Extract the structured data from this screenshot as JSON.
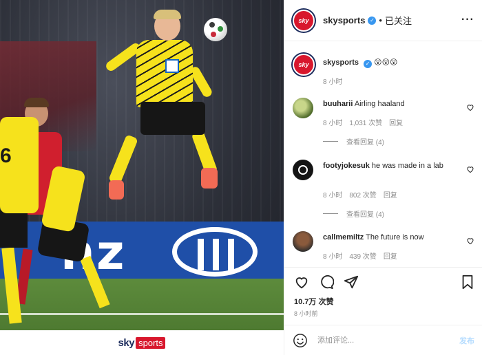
{
  "photo": {
    "alt_icon": "football-photo",
    "ad_text": "nz",
    "watermark": {
      "brand": "sky",
      "sub": "sports"
    },
    "players": {
      "left_number": "6",
      "red_number": "6"
    },
    "colors": {
      "kit_yellow": "#f6e21c",
      "kit_black": "#161616",
      "opponent_red": "#d01f2e",
      "adboard_blue": "#1f4fa8",
      "boot": "#f26b55"
    }
  },
  "header": {
    "avatar_text": "sky",
    "username": "skysports",
    "verified_icon": "verified-badge-icon",
    "separator": "•",
    "follow_status": "已关注",
    "more_icon": "more-options-icon"
  },
  "caption": {
    "username": "skysports",
    "text": "😲😲😲",
    "time": "8 小时"
  },
  "comments": [
    {
      "username": "buuharii",
      "text": "Airling haaland",
      "time": "8 小时",
      "likes": "1,031 次赞",
      "reply": "回复",
      "view_replies": "查看回复 (4)"
    },
    {
      "username": "footyjokesuk",
      "text": "he was made in a lab",
      "time": "8 小时",
      "likes": "802 次赞",
      "reply": "回复",
      "view_replies": "查看回复 (4)"
    },
    {
      "username": "callmemiltz",
      "text": "The future is now",
      "time": "8 小时",
      "likes": "439 次赞",
      "reply": "回复"
    }
  ],
  "actions": {
    "like_icon": "heart-icon",
    "comment_icon": "comment-bubble-icon",
    "share_icon": "send-icon",
    "save_icon": "bookmark-icon",
    "likes": "10.7万 次赞",
    "time": "8 小时前"
  },
  "composer": {
    "emoji_icon": "emoji-icon",
    "placeholder": "添加评论...",
    "post_label": "发布"
  },
  "colors": {
    "verified": "#3897f0",
    "muted": "#8e8e8e",
    "sky_red": "#d8172d",
    "sky_navy": "#1b2b5c",
    "post_disabled": "#b3dbff"
  }
}
